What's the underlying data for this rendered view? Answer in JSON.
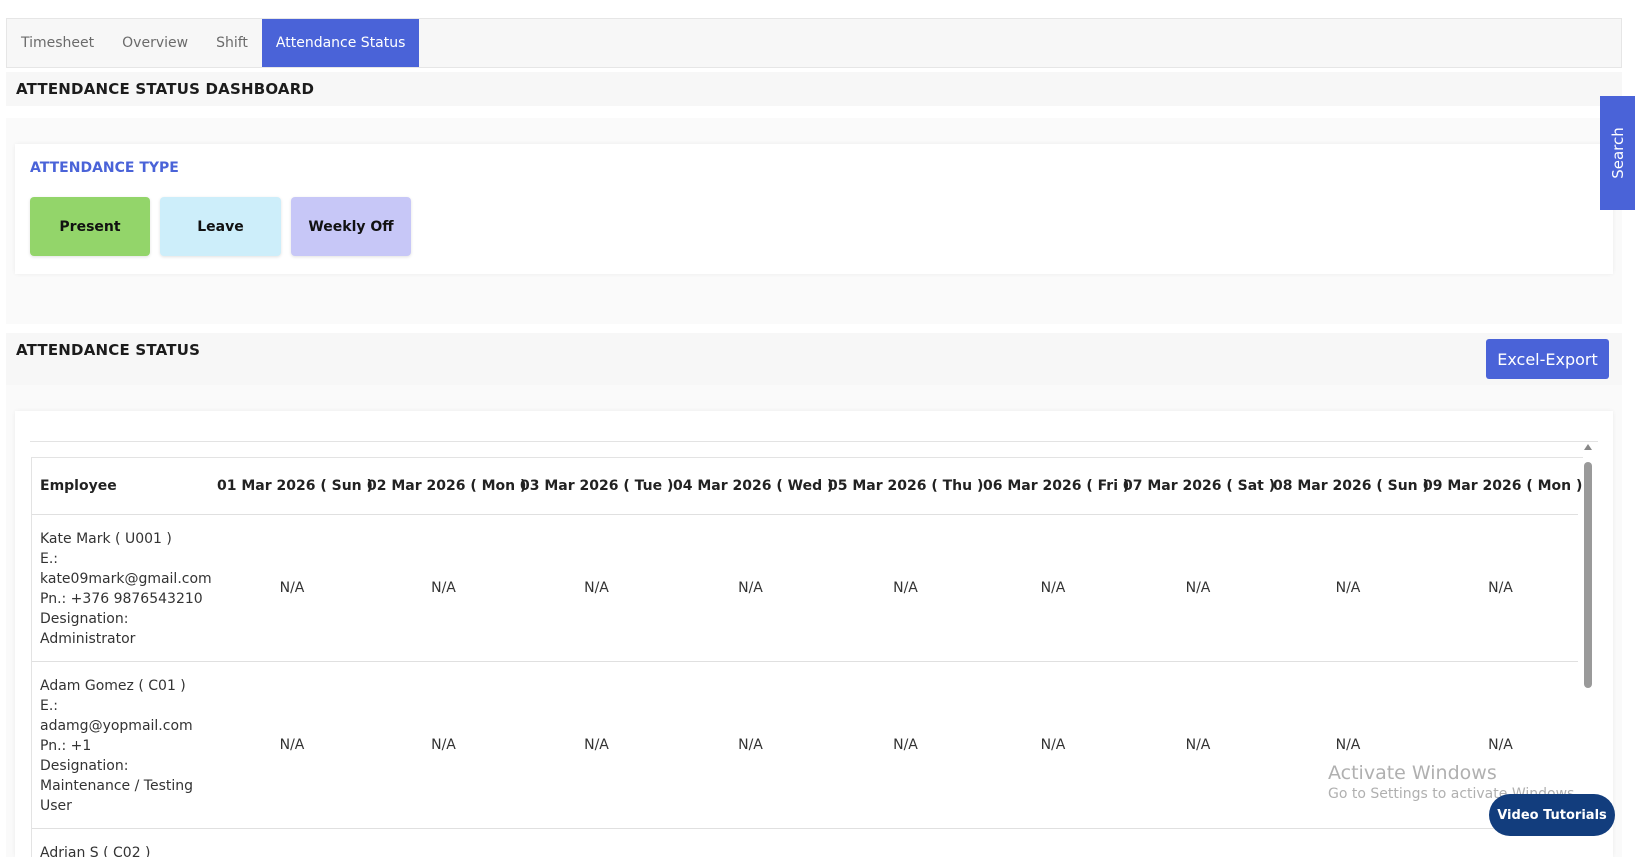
{
  "tabs": [
    {
      "label": "Timesheet"
    },
    {
      "label": "Overview"
    },
    {
      "label": "Shift"
    },
    {
      "label": "Attendance Status",
      "active": true
    }
  ],
  "dashboard": {
    "title": "ATTENDANCE STATUS DASHBOARD"
  },
  "attendance_type": {
    "title": "ATTENDANCE TYPE",
    "items": [
      {
        "label": "Present",
        "color": "#93d56a"
      },
      {
        "label": "Leave",
        "color": "#cdeefa"
      },
      {
        "label": "Weekly Off",
        "color": "#c7c7f7"
      }
    ]
  },
  "status": {
    "title": "ATTENDANCE STATUS",
    "export_label": "Excel-Export"
  },
  "search_tab": {
    "label": "Search"
  },
  "table": {
    "columns": [
      "Employee",
      "01 Mar 2026 ( Sun )",
      "02 Mar 2026 ( Mon )",
      "03 Mar 2026 ( Tue )",
      "04 Mar 2026 ( Wed )",
      "05 Mar 2026 ( Thu )",
      "06 Mar 2026 ( Fri )",
      "07 Mar 2026 ( Sat )",
      "08 Mar 2026 ( Sun )",
      "09 Mar 2026 ( Mon )"
    ],
    "rows": [
      {
        "employee": [
          "Kate Mark ( U001 )",
          "E.:",
          "kate09mark@gmail.com",
          "Pn.: +376 9876543210",
          "Designation:",
          "Administrator"
        ],
        "values": [
          "N/A",
          "N/A",
          "N/A",
          "N/A",
          "N/A",
          "N/A",
          "N/A",
          "N/A",
          "N/A"
        ]
      },
      {
        "employee": [
          "Adam Gomez ( C01 )",
          "E.:",
          "adamg@yopmail.com",
          "Pn.: +1",
          "Designation:",
          "Maintenance / Testing",
          "User"
        ],
        "values": [
          "N/A",
          "N/A",
          "N/A",
          "N/A",
          "N/A",
          "N/A",
          "N/A",
          "N/A",
          "N/A"
        ]
      },
      {
        "employee": [
          "Adrian S ( C02 )"
        ],
        "values": [
          "",
          "",
          "",
          "",
          "",
          "",
          "",
          "",
          ""
        ]
      }
    ]
  },
  "overlay": {
    "activate_title": "Activate Windows",
    "activate_sub": "Go to Settings to activate Windows.",
    "video_label": "Video Tutorials"
  }
}
